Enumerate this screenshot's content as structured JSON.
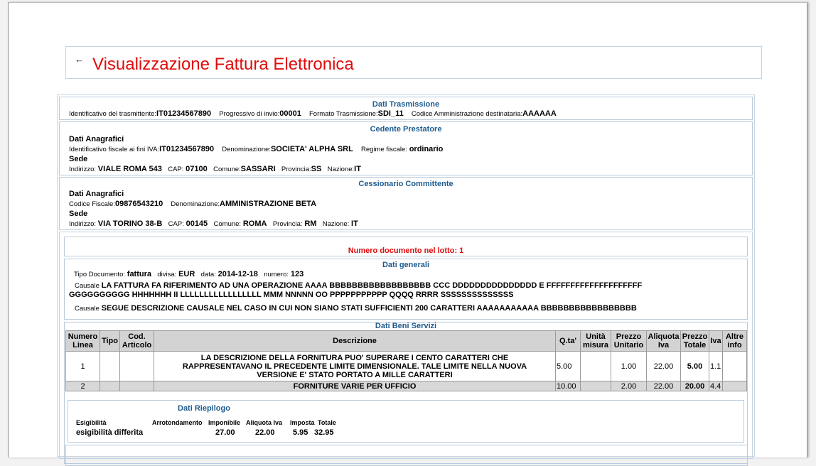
{
  "title": "Visualizzazione Fattura Elettronica",
  "back_glyph": "←",
  "trasmissione": {
    "title": "Dati Trasmissione",
    "id_label": "Identificativo del trasmittente:",
    "id_value": "IT01234567890",
    "prog_label": "Progressivo di invio:",
    "prog_value": "00001",
    "formato_label": "Formato Trasmissione:",
    "formato_value": "SDI_11",
    "codice_label": "Codice Amministrazione destinataria:",
    "codice_value": "AAAAAA"
  },
  "cedente": {
    "title": "Cedente Prestatore",
    "anagrafici": "Dati Anagrafici",
    "idfisc_label": "Identificativo fiscale ai fini IVA:",
    "idfisc_value": "IT01234567890",
    "denom_label": "Denominazione:",
    "denom_value": "SOCIETA' ALPHA SRL",
    "regime_label": "Regime fiscale:",
    "regime_value": "ordinario",
    "sede": "Sede",
    "indirizzo_label": "Indirizzo:",
    "indirizzo_value": "VIALE ROMA 543",
    "cap_label": "CAP:",
    "cap_value": "07100",
    "comune_label": "Comune:",
    "comune_value": "SASSARI",
    "prov_label": "Provincia:",
    "prov_value": "SS",
    "naz_label": "Nazione:",
    "naz_value": "IT"
  },
  "cessionario": {
    "title": "Cessionario Committente",
    "anagrafici": "Dati Anagrafici",
    "cf_label": "Codice Fiscale:",
    "cf_value": "09876543210",
    "denom_label": "Denominazione:",
    "denom_value": "AMMINISTRAZIONE BETA",
    "sede": "Sede",
    "indirizzo_label": "Indirizzo:",
    "indirizzo_value": "VIA TORINO 38-B",
    "cap_label": "CAP:",
    "cap_value": "00145",
    "comune_label": "Comune:",
    "comune_value": "ROMA",
    "prov_label": "Provincia:",
    "prov_value": "RM",
    "naz_label": "Nazione:",
    "naz_value": "IT"
  },
  "lotto": {
    "title": "Numero documento nel lotto: 1"
  },
  "generali": {
    "title": "Dati generali",
    "tipo_label": "Tipo Documento:",
    "tipo_value": "fattura",
    "divisa_label": "divisa:",
    "divisa_value": "EUR",
    "data_label": "data:",
    "data_value": "2014-12-18",
    "numero_label": "numero:",
    "numero_value": "123",
    "causale_label": "Causale",
    "causale1_line1": "LA FATTURA FA RIFERIMENTO AD UNA OPERAZIONE AAAA BBBBBBBBBBBBBBBBBB CCC DDDDDDDDDDDDDDD E FFFFFFFFFFFFFFFFFFFF",
    "causale1_line2": "GGGGGGGGGG HHHHHHH II LLLLLLLLLLLLLLLLL MMM NNNNN OO PPPPPPPPPPP QQQQ RRRR SSSSSSSSSSSSSS",
    "causale2": "SEGUE DESCRIZIONE CAUSALE NEL CASO IN CUI NON SIANO STATI SUFFICIENTI 200 CARATTERI AAAAAAAAAAA BBBBBBBBBBBBBBBBB"
  },
  "beni": {
    "title": "Dati Beni Servizi",
    "headers": {
      "numero1": "Numero",
      "numero2": "Linea",
      "tipo": "Tipo",
      "cod1": "Cod.",
      "cod2": "Articolo",
      "descr": "Descrizione",
      "qta": "Q.ta'",
      "unita1": "Unità",
      "unita2": "misura",
      "prezzo1": "Prezzo",
      "prezzo2": "Unitario",
      "aliq1": "Aliquota",
      "aliq2": "Iva",
      "ptot1": "Prezzo",
      "ptot2": "Totale",
      "iva": "Iva",
      "altre1": "Altre",
      "altre2": "info"
    },
    "rows": [
      {
        "num": "1",
        "tipo": "",
        "cod": "",
        "descr_l1": "LA DESCRIZIONE DELLA FORNITURA PUO' SUPERARE I CENTO CARATTERI CHE",
        "descr_l2": "RAPPRESENTAVANO IL PRECEDENTE LIMITE DIMENSIONALE. TALE LIMITE NELLA NUOVA",
        "descr_l3": "VERSIONE E' STATO PORTATO A MILLE CARATTERI",
        "qta": "5.00",
        "unita": "",
        "prezzo": "1.00",
        "aliquota": "22.00",
        "totale": "5.00",
        "iva": "1.1",
        "altre": ""
      },
      {
        "num": "2",
        "tipo": "",
        "cod": "",
        "descr": "FORNITURE VARIE PER UFFICIO",
        "qta": "10.00",
        "unita": "",
        "prezzo": "2.00",
        "aliquota": "22.00",
        "totale": "20.00",
        "iva": "4.4",
        "altre": ""
      }
    ]
  },
  "riepilogo": {
    "title": "Dati Riepilogo",
    "h_esig": "Esigibilità",
    "h_arr": "Arrotondamento",
    "h_impon": "Imponibile",
    "h_aliq": "Aliquota Iva",
    "h_imposta": "Imposta",
    "h_totale": "Totale",
    "esig": "esigibilità differita",
    "impon": "27.00",
    "aliq": "22.00",
    "imposta": "5.95",
    "totale": "32.95"
  }
}
